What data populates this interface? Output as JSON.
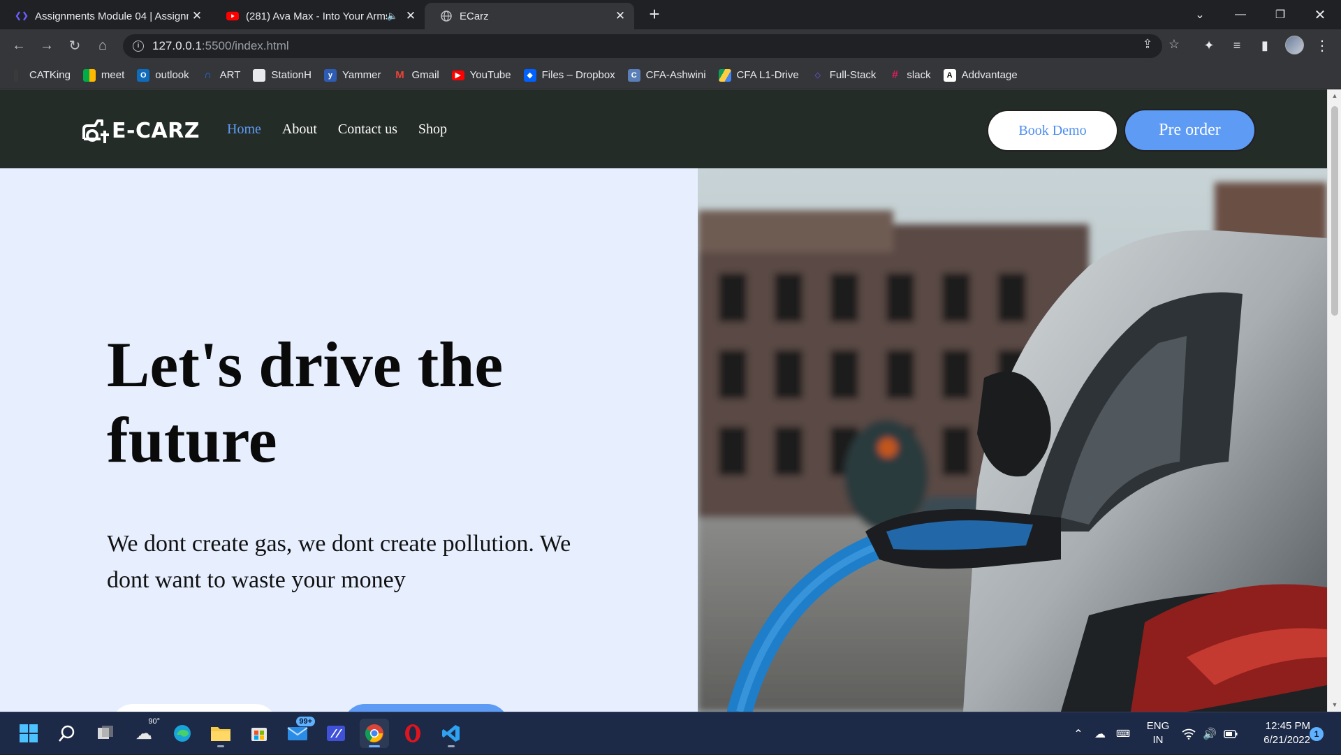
{
  "browser": {
    "tabs": [
      {
        "title": "Assignments Module 04 | Assignm",
        "active": false,
        "icon": "bracket-logo-icon"
      },
      {
        "title": "(281) Ava Max - Into Your Arms",
        "active": false,
        "icon": "youtube-icon",
        "audio": true
      },
      {
        "title": "ECarz",
        "active": true,
        "icon": "globe-icon"
      }
    ],
    "url_host": "127.0.0.1",
    "url_path": ":5500/index.html",
    "bookmarks": [
      "CATKing",
      "meet",
      "outlook",
      "ART",
      "StationH",
      "Yammer",
      "Gmail",
      "YouTube",
      "Files – Dropbox",
      "CFA-Ashwini",
      "CFA L1-Drive",
      "Full-Stack",
      "slack",
      "Addvantage"
    ]
  },
  "site": {
    "logo_text": "E-CARZ",
    "nav": [
      "Home",
      "About",
      "Contact us",
      "Shop"
    ],
    "active_nav": "Home",
    "book_demo_label": "Book Demo",
    "pre_order_label": "Pre order",
    "hero_title": "Let's drive the future",
    "hero_subtitle": "We dont create gas, we dont create pollution. We dont want to waste your money",
    "hero_image": "ev-charging-car-photo",
    "colors": {
      "nav_bg": "#242c27",
      "accent": "#5d9bf5",
      "hero_bg": "#e7efff"
    }
  },
  "taskbar": {
    "weather": "90°",
    "mail_badge": "99+",
    "lang_top": "ENG",
    "lang_bottom": "IN",
    "time": "12:45 PM",
    "date": "6/21/2022",
    "notifications": "1"
  }
}
